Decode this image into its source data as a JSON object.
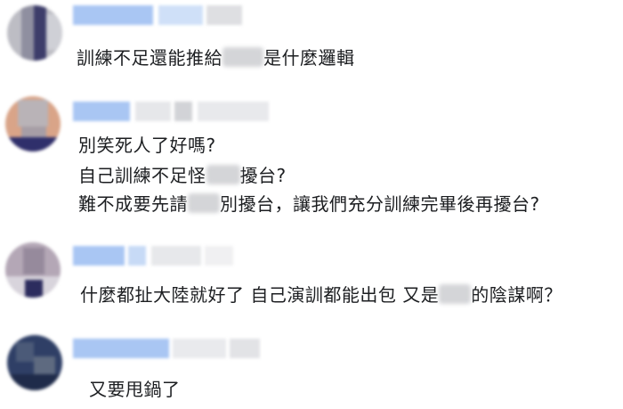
{
  "comments": [
    {
      "line1": {
        "before": "訓練不足還能推給",
        "after": "是什麼邏輯"
      }
    },
    {
      "line1": "別笑死人了好嗎?",
      "line2": {
        "before": "自己訓練不足怪",
        "after": "擾台?"
      },
      "line3": {
        "before": "難不成要先請",
        "after": "別擾台，讓我們充分訓練完畢後再擾台?"
      }
    },
    {
      "line1": {
        "before": "什麼都扯大陸就好了 自己演訓都能出包 又是",
        "after": "的陰謀啊？"
      }
    },
    {
      "line1": "又要甩鍋了"
    }
  ]
}
